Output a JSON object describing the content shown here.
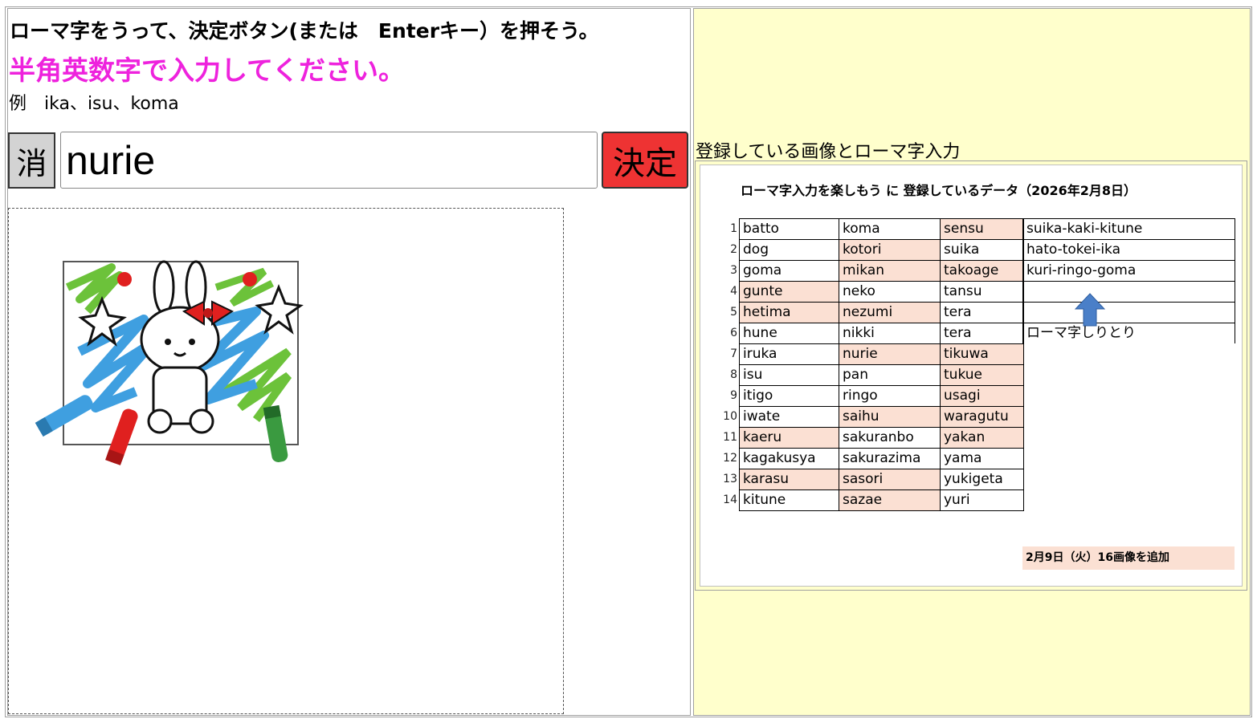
{
  "instructions": {
    "line1": "ローマ字をうって、決定ボタン(または　Enterキー）を押そう。",
    "line2": "半角英数字で入力してください。",
    "example": "例　ika、isu、koma"
  },
  "controls": {
    "clear_label": "消",
    "input_value": "nurie",
    "decide_label": "決定"
  },
  "registered": {
    "label": "登録している画像とローマ字入力",
    "sheet_title": "ローマ字入力を楽しもう に 登録しているデータ（2026年2月8日）",
    "rows": [
      {
        "n": "1",
        "c1": "batto",
        "c2": "koma",
        "c3": "sensu"
      },
      {
        "n": "2",
        "c1": "dog",
        "c2": "kotori",
        "c3": "suika"
      },
      {
        "n": "3",
        "c1": "goma",
        "c2": "mikan",
        "c3": "takoage"
      },
      {
        "n": "4",
        "c1": "gunte",
        "c2": "neko",
        "c3": "tansu"
      },
      {
        "n": "5",
        "c1": "hetima",
        "c2": "nezumi",
        "c3": "tera"
      },
      {
        "n": "6",
        "c1": "hune",
        "c2": "nikki",
        "c3": "tera"
      },
      {
        "n": "7",
        "c1": "iruka",
        "c2": "nurie",
        "c3": "tikuwa"
      },
      {
        "n": "8",
        "c1": "isu",
        "c2": "pan",
        "c3": "tukue"
      },
      {
        "n": "9",
        "c1": "itigo",
        "c2": "ringo",
        "c3": "usagi"
      },
      {
        "n": "10",
        "c1": "iwate",
        "c2": "saihu",
        "c3": "waragutu"
      },
      {
        "n": "11",
        "c1": "kaeru",
        "c2": "sakuranbo",
        "c3": "yakan"
      },
      {
        "n": "12",
        "c1": "kagakusya",
        "c2": "sakurazima",
        "c3": "yama"
      },
      {
        "n": "13",
        "c1": "karasu",
        "c2": "sasori",
        "c3": "yukigeta"
      },
      {
        "n": "14",
        "c1": "kitune",
        "c2": "sazae",
        "c3": "yuri"
      }
    ],
    "chain": [
      "suika-kaki-kitune",
      "hato-tokei-ika",
      "kuri-ringo-goma",
      "",
      "",
      "ローマ字しりとり"
    ],
    "note": "2月9日（火）16画像を追加",
    "colors": {
      "highlight": "#fbe0d3",
      "panel": "#ffffcc",
      "warn": "#ee22dd",
      "decide": "#ee3333",
      "arrow": "#4a7fc8"
    }
  }
}
